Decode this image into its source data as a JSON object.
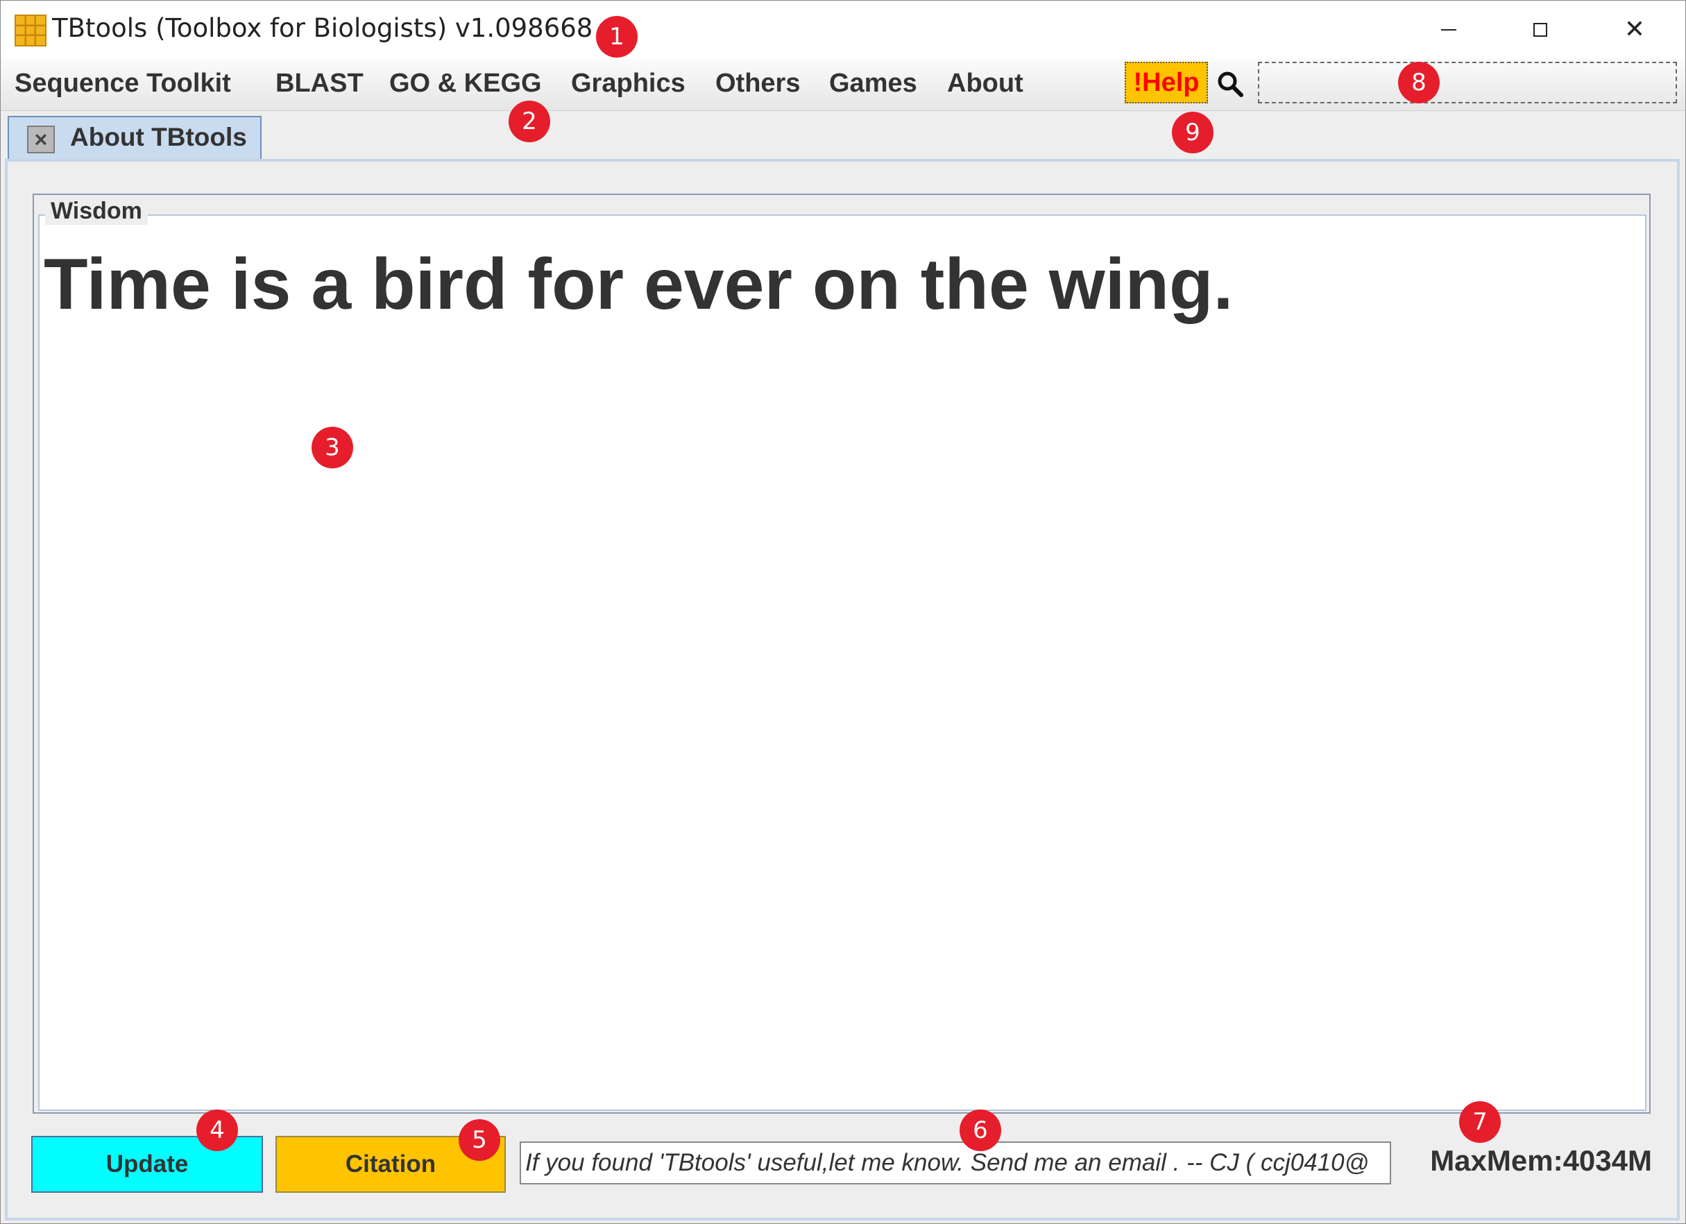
{
  "window": {
    "title": "TBtools (Toolbox for Biologists) v1.098668",
    "icon": "tbtools-grid-icon"
  },
  "title_buttons": {
    "minimize": "minimize-icon",
    "maximize": "maximize-icon",
    "close": "✕"
  },
  "menu": {
    "items": [
      {
        "label": "Sequence Toolkit"
      },
      {
        "label": "BLAST"
      },
      {
        "label": "GO & KEGG"
      },
      {
        "label": "Graphics"
      },
      {
        "label": "Others"
      },
      {
        "label": "Games"
      },
      {
        "label": "About"
      }
    ],
    "help_label": "!Help",
    "search_icon": "magnifier-icon",
    "search_value": ""
  },
  "tabs": [
    {
      "label": "About TBtools",
      "close": "×"
    }
  ],
  "wisdom": {
    "legend": "Wisdom",
    "quote": "Time is a bird for ever on the wing."
  },
  "footer": {
    "update_label": "Update",
    "citation_label": "Citation",
    "email_text": "If you found 'TBtools' useful,let me know. Send me an email . -- CJ   ( ccj0410@",
    "maxmem": "MaxMem:4034M"
  },
  "markers": [
    "1",
    "2",
    "3",
    "4",
    "5",
    "6",
    "7",
    "8",
    "9"
  ],
  "colors": {
    "update_bg": "#00ffff",
    "citation_bg": "#ffc400",
    "help_bg": "#ffc400",
    "help_text": "#ff0000",
    "marker": "#e61e2b",
    "tab_bg": "#c9dbef"
  }
}
